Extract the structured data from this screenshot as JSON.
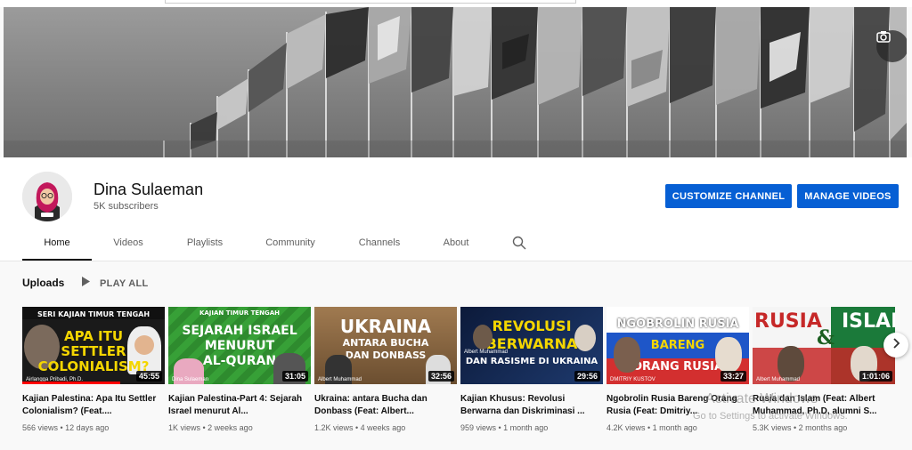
{
  "channel": {
    "name": "Dina Sulaeman",
    "subscribers": "5K subscribers"
  },
  "buttons": {
    "customize": "CUSTOMIZE CHANNEL",
    "manage": "MANAGE VIDEOS"
  },
  "tabs": [
    "Home",
    "Videos",
    "Playlists",
    "Community",
    "Channels",
    "About"
  ],
  "section": {
    "title": "Uploads",
    "play_all": "PLAY ALL"
  },
  "videos": [
    {
      "title": "Kajian Palestina: Apa Itu Settler Colonialism? (Feat....",
      "duration": "45:55",
      "meta": "566 views • 12 days ago",
      "thumb_lines": [
        "SERI KAJIAN TIMUR TENGAH",
        "APA ITU",
        "SETTLER",
        "COLONIALISM?"
      ],
      "thumb_caption": "Airlangga Pribadi, Ph.D."
    },
    {
      "title": "Kajian Palestina-Part 4: Sejarah Israel menurut Al...",
      "duration": "31:05",
      "meta": "1K views • 2 weeks ago",
      "thumb_lines": [
        "KAJIAN TIMUR TENGAH",
        "SEJARAH ISRAEL",
        "MENURUT",
        "AL-QURAN"
      ],
      "thumb_caption": "Dina Sulaeman"
    },
    {
      "title": "Ukraina: antara Bucha dan Donbass (Feat: Albert...",
      "duration": "32:56",
      "meta": "1.2K views • 4 weeks ago",
      "thumb_lines": [
        "UKRAINA",
        "ANTARA BUCHA",
        "DAN DONBASS"
      ],
      "thumb_caption": "Albert Muhammad"
    },
    {
      "title": "Kajian Khusus: Revolusi Berwarna dan Diskriminasi ...",
      "duration": "29:56",
      "meta": "959 views • 1 month ago",
      "thumb_lines": [
        "REVOLUSI",
        "BERWARNA",
        "DAN RASISME DI UKRAINA"
      ],
      "thumb_caption": "Albert Muhammad"
    },
    {
      "title": "Ngobrolin Rusia Bareng Orang Rusia (Feat: Dmitriy...",
      "duration": "33:27",
      "meta": "4.2K views • 1 month ago",
      "thumb_lines": [
        "NGOBROLIN RUSIA",
        "BARENG",
        "ORANG RUSIA"
      ],
      "thumb_caption": "DMITRIY KUSTOV"
    },
    {
      "title": "Rusia dan Islam (Feat: Albert Muhammad, Ph.D, alumni S...",
      "duration": "1:01:06",
      "meta": "5.3K views • 2 months ago",
      "thumb_lines": [
        "RUSIA",
        "&",
        "ISLAM"
      ],
      "thumb_caption": "Albert Muhammad"
    }
  ],
  "watermark": {
    "line1": "Activate Windows",
    "line2": "Go to Settings to activate Windows."
  },
  "icons": {
    "camera": "camera-icon",
    "search": "search-icon",
    "play": "play-icon",
    "next": "chevron-right-icon"
  },
  "colors": {
    "accent": "#065fd4",
    "progress": "#ff0000"
  }
}
